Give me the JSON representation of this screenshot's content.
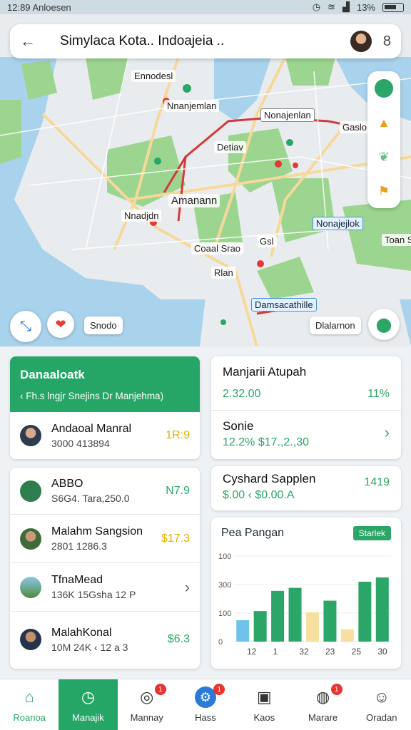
{
  "status": {
    "time": "12:89",
    "carrier": "Anloesen",
    "battery": "13%"
  },
  "search": {
    "title": "Simylaса Kota.. Indoajеіа .."
  },
  "map": {
    "labels": [
      "Ennodesl",
      "Nnanjemlan",
      "Nonajenlan",
      "Gaslo",
      "Detiav",
      "Amanann",
      "Nnadjdn",
      "Nonajejlok",
      "Toan Sek",
      "Coaal Srao",
      "Gsl",
      "Rlan",
      "Damsacathille"
    ],
    "chip_left": "Snodo",
    "chip_right": "Dlalarnon"
  },
  "left_card": {
    "title": "Danaaloatk",
    "subtitle": "‹ Fh.s lngjr Snejins  Dr Manjehma)",
    "rows": [
      {
        "name": "Andaoal Manral",
        "sub": "3000  413894",
        "value": "1R:9",
        "color": "#e2b300"
      }
    ]
  },
  "people_card": {
    "rows": [
      {
        "name": "ABBO",
        "sub": "S6G4. Tara,250.0",
        "value": "N7.9",
        "color": "#2ba568"
      },
      {
        "name": "Malahm Sangsion",
        "sub": "2801  1286.3",
        "value": "$17.3",
        "color": "#e2b300"
      },
      {
        "name": "TfnaMead",
        "sub": "136K  15Gsha 12 P",
        "value": "›",
        "color": "#666"
      },
      {
        "name": "MalahKonal",
        "sub": "10M  24K ‹ 12 a 3",
        "value": "$6.3",
        "color": "#2ba568"
      }
    ]
  },
  "stat1": {
    "label": "Manjarii Atupah",
    "value": "2.32.00",
    "pct": "11%"
  },
  "stat2": {
    "label": "Sonie",
    "value": "12.2%  $17.,2.,30",
    "pct": "›"
  },
  "stat3": {
    "label": "Cyshard Sapplen",
    "value": "$.00 ‹ $0.00.A",
    "pct": "1419"
  },
  "chart_card": {
    "title": "Pea Pangan",
    "badge": "Starlek"
  },
  "chart_data": {
    "type": "bar",
    "categories": [
      "12",
      "1",
      "32",
      "23",
      "25",
      "30"
    ],
    "yticks": [
      "100",
      "300",
      "100",
      "0"
    ],
    "series": [
      {
        "values": [
          38,
          57,
          100,
          105,
          52,
          80,
          115,
          130
        ]
      }
    ],
    "colors": [
      "#6fc3ea",
      "#2ba568",
      "#2ba568",
      "#2ba568",
      "#f6dfa0",
      "#2ba568",
      "#f6dfa0",
      "#2ba568",
      "#2ba568"
    ]
  },
  "nav": [
    {
      "label": "Roanoa",
      "icon": "home-icon",
      "badge": ""
    },
    {
      "label": "Manajіk",
      "icon": "clock-icon",
      "badge": ""
    },
    {
      "label": "Mannay",
      "icon": "location-icon",
      "badge": "1"
    },
    {
      "label": "Hass",
      "icon": "gear-icon",
      "badge": "1"
    },
    {
      "label": "Kaos",
      "icon": "box-icon",
      "badge": ""
    },
    {
      "label": "Marare",
      "icon": "dial-icon",
      "badge": "1"
    },
    {
      "label": "Oradan",
      "icon": "user-icon",
      "badge": ""
    }
  ]
}
